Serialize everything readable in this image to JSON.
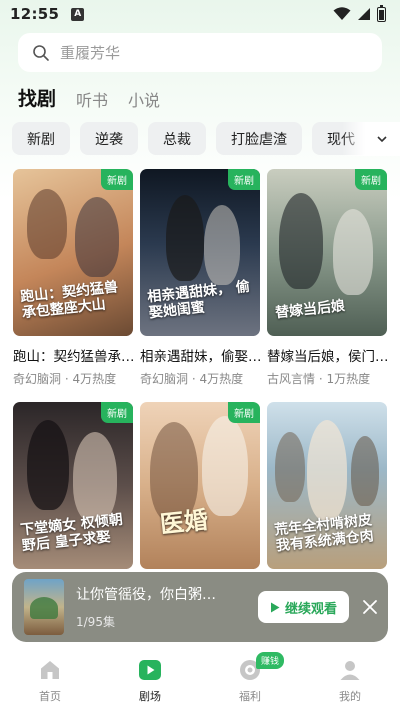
{
  "status_bar": {
    "time": "12:55",
    "app_indicator": "A"
  },
  "search": {
    "placeholder": "重履芳华"
  },
  "top_tabs": [
    {
      "label": "找剧",
      "active": true
    },
    {
      "label": "听书",
      "active": false
    },
    {
      "label": "小说",
      "active": false
    }
  ],
  "categories": [
    "新剧",
    "逆袭",
    "总裁",
    "打脸虐渣",
    "现代"
  ],
  "cards": [
    {
      "title": "跑山：契约猛兽承包整座大山",
      "meta": "奇幻脑洞 · 4万热度",
      "badge": "新剧",
      "poster_text": "跑山：契约猛兽 承包整座大山",
      "colors": [
        "#c4865a",
        "#f1d7b3"
      ]
    },
    {
      "title": "相亲遇甜妹，偷娶她闺蜜",
      "meta": "奇幻脑洞 · 4万热度",
      "badge": "新剧",
      "poster_text": "相亲遇甜妹， 偷娶她闺蜜",
      "colors": [
        "#1e2a3a",
        "#5a6b7c"
      ]
    },
    {
      "title": "替嫁当后娘，侯门主母",
      "meta": "古风言情 · 1万热度",
      "badge": "新剧",
      "poster_text": "替嫁当后娘",
      "colors": [
        "#8a9a8c",
        "#d8dccd"
      ]
    },
    {
      "title": "下堂嫡女权倾朝野后",
      "meta": "",
      "badge": "新剧",
      "poster_text": "下堂嫡女 权倾朝野后 皇子求娶",
      "colors": [
        "#3a3436",
        "#8c7a72"
      ]
    },
    {
      "title": "医婚",
      "meta": "",
      "badge": "新剧",
      "poster_text": "医婚",
      "colors": [
        "#d8b08a",
        "#f3e2cf"
      ]
    },
    {
      "title": "荒年全村啃树皮，我有系统满仓肉",
      "meta": "",
      "badge": "",
      "poster_text": "荒年全村啃树皮 我有系统满仓肉",
      "colors": [
        "#9cb8c8",
        "#e8d9c0"
      ]
    }
  ],
  "mini_player": {
    "title": "让你管徭役，你白粥…",
    "episodes": "1/95集",
    "resume_label": "继续观看"
  },
  "bottom_nav": [
    {
      "label": "首页",
      "icon": "home-icon",
      "active": false
    },
    {
      "label": "剧场",
      "icon": "theater-play-icon",
      "active": true
    },
    {
      "label": "福利",
      "icon": "coin-icon",
      "active": false,
      "badge": "赚钱"
    },
    {
      "label": "我的",
      "icon": "person-icon",
      "active": false
    }
  ],
  "colors": {
    "accent": "#27b35d",
    "chip_bg": "#eef0f1"
  }
}
